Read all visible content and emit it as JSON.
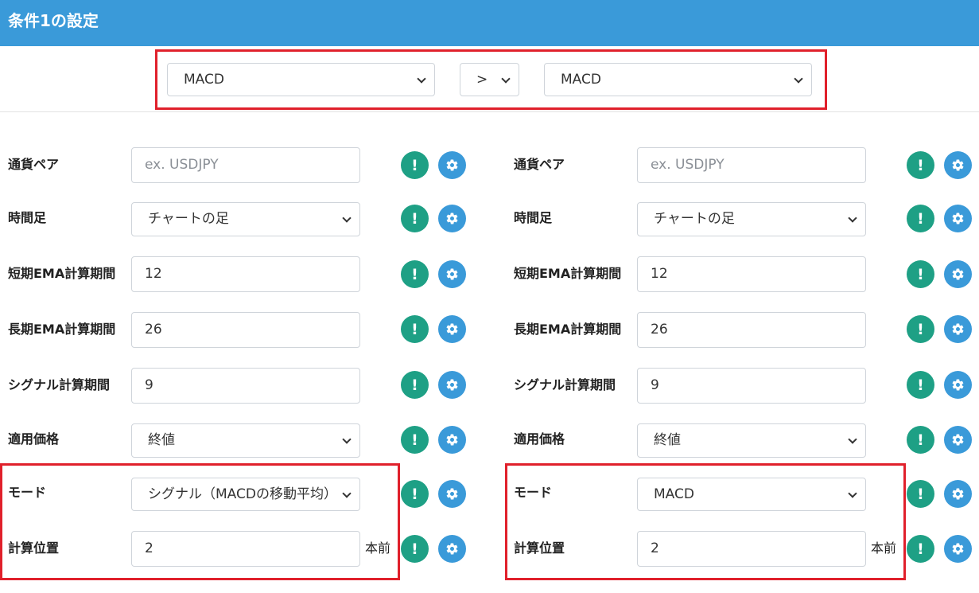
{
  "header": {
    "title": "条件1の設定"
  },
  "comparison": {
    "left": "MACD",
    "operator": ">",
    "right": "MACD"
  },
  "left": {
    "currency_pair": {
      "label": "通貨ペア",
      "placeholder": "ex. USDJPY"
    },
    "timeframe": {
      "label": "時間足",
      "value": "チャートの足"
    },
    "short_ema": {
      "label": "短期EMA計算期間",
      "value": "12"
    },
    "long_ema": {
      "label": "長期EMA計算期間",
      "value": "26"
    },
    "signal": {
      "label": "シグナル計算期間",
      "value": "9"
    },
    "price": {
      "label": "適用価格",
      "value": "終値"
    },
    "mode": {
      "label": "モード",
      "value": "シグナル（MACDの移動平均）"
    },
    "position": {
      "label": "計算位置",
      "value": "2",
      "suffix": "本前"
    }
  },
  "right": {
    "currency_pair": {
      "label": "通貨ペア",
      "placeholder": "ex. USDJPY"
    },
    "timeframe": {
      "label": "時間足",
      "value": "チャートの足"
    },
    "short_ema": {
      "label": "短期EMA計算期間",
      "value": "12"
    },
    "long_ema": {
      "label": "長期EMA計算期間",
      "value": "26"
    },
    "signal": {
      "label": "シグナル計算期間",
      "value": "9"
    },
    "price": {
      "label": "適用価格",
      "value": "終値"
    },
    "mode": {
      "label": "モード",
      "value": "MACD"
    },
    "position": {
      "label": "計算位置",
      "value": "2",
      "suffix": "本前"
    }
  },
  "icons": {
    "info": "!",
    "info_name": "exclamation-icon",
    "gear_name": "gear-icon"
  },
  "colors": {
    "header": "#3a9ad9",
    "info": "#1ea085",
    "gear": "#3a9ad9",
    "highlight": "#e0202b"
  }
}
